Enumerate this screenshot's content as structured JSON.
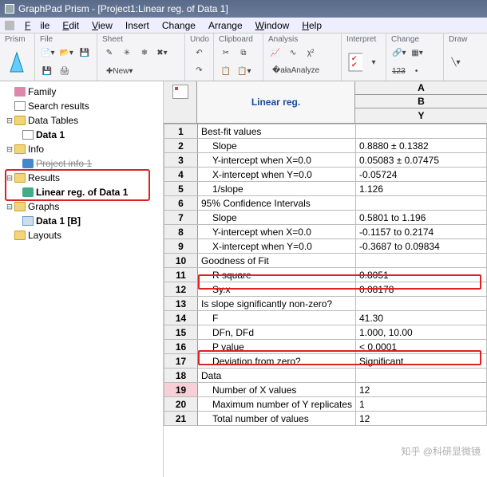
{
  "window": {
    "title": "GraphPad Prism - [Project1:Linear reg. of Data 1]"
  },
  "menu": {
    "file": "File",
    "edit": "Edit",
    "view": "View",
    "insert": "Insert",
    "change": "Change",
    "arrange": "Arrange",
    "window": "Window",
    "help": "Help"
  },
  "ribbon": {
    "prism": "Prism",
    "file": "File",
    "sheet": "Sheet",
    "undo": "Undo",
    "clipboard": "Clipboard",
    "analysis": "Analysis",
    "interpret": "Interpret",
    "changeg": "Change",
    "draw": "Draw",
    "new": "New",
    "analyze": "Analyze",
    "strike123": "123"
  },
  "tree": {
    "family": "Family",
    "search": "Search results",
    "tables": "Data Tables",
    "data1": "Data 1",
    "info": "Info",
    "projinfo": "Project info 1",
    "results": "Results",
    "linres": "Linear reg. of Data 1",
    "graphs": "Graphs",
    "data1b": "Data 1 [B]",
    "layouts": "Layouts"
  },
  "grid": {
    "title": "Linear reg.",
    "colA": "A",
    "colB": "B",
    "colY": "Y",
    "rows": [
      {
        "n": "1",
        "k": "Best-fit values",
        "v": "",
        "ind": 0
      },
      {
        "n": "2",
        "k": "Slope",
        "v": "0.8880 ± 0.1382",
        "ind": 1
      },
      {
        "n": "3",
        "k": "Y-intercept when X=0.0",
        "v": "0.05083 ± 0.07475",
        "ind": 1
      },
      {
        "n": "4",
        "k": "X-intercept when Y=0.0",
        "v": "-0.05724",
        "ind": 1
      },
      {
        "n": "5",
        "k": "1/slope",
        "v": "1.126",
        "ind": 1
      },
      {
        "n": "6",
        "k": "95% Confidence Intervals",
        "v": "",
        "ind": 0
      },
      {
        "n": "7",
        "k": "Slope",
        "v": "0.5801 to 1.196",
        "ind": 1
      },
      {
        "n": "8",
        "k": "Y-intercept when X=0.0",
        "v": "-0.1157 to 0.2174",
        "ind": 1
      },
      {
        "n": "9",
        "k": "X-intercept when Y=0.0",
        "v": "-0.3687 to 0.09834",
        "ind": 1
      },
      {
        "n": "10",
        "k": "Goodness of Fit",
        "v": "",
        "ind": 0
      },
      {
        "n": "11",
        "k": "R square",
        "v": "0.8051",
        "ind": 1,
        "hl": true
      },
      {
        "n": "12",
        "k": "Sy.x",
        "v": "0.08178",
        "ind": 1
      },
      {
        "n": "13",
        "k": "Is slope significantly non-zero?",
        "v": "",
        "ind": 0
      },
      {
        "n": "14",
        "k": "F",
        "v": "41.30",
        "ind": 1
      },
      {
        "n": "15",
        "k": "DFn, DFd",
        "v": "1.000, 10.00",
        "ind": 1
      },
      {
        "n": "16",
        "k": "P value",
        "v": "< 0.0001",
        "ind": 1,
        "hl": true
      },
      {
        "n": "17",
        "k": "Deviation from zero?",
        "v": "Significant",
        "ind": 1
      },
      {
        "n": "18",
        "k": "Data",
        "v": "",
        "ind": 0
      },
      {
        "n": "19",
        "k": "Number of X values",
        "v": "12",
        "ind": 1,
        "sel": true
      },
      {
        "n": "20",
        "k": "Maximum number of Y replicates",
        "v": "1",
        "ind": 1
      },
      {
        "n": "21",
        "k": "Total number of values",
        "v": "12",
        "ind": 1
      }
    ]
  },
  "watermark": "知乎 @科研显微镜"
}
